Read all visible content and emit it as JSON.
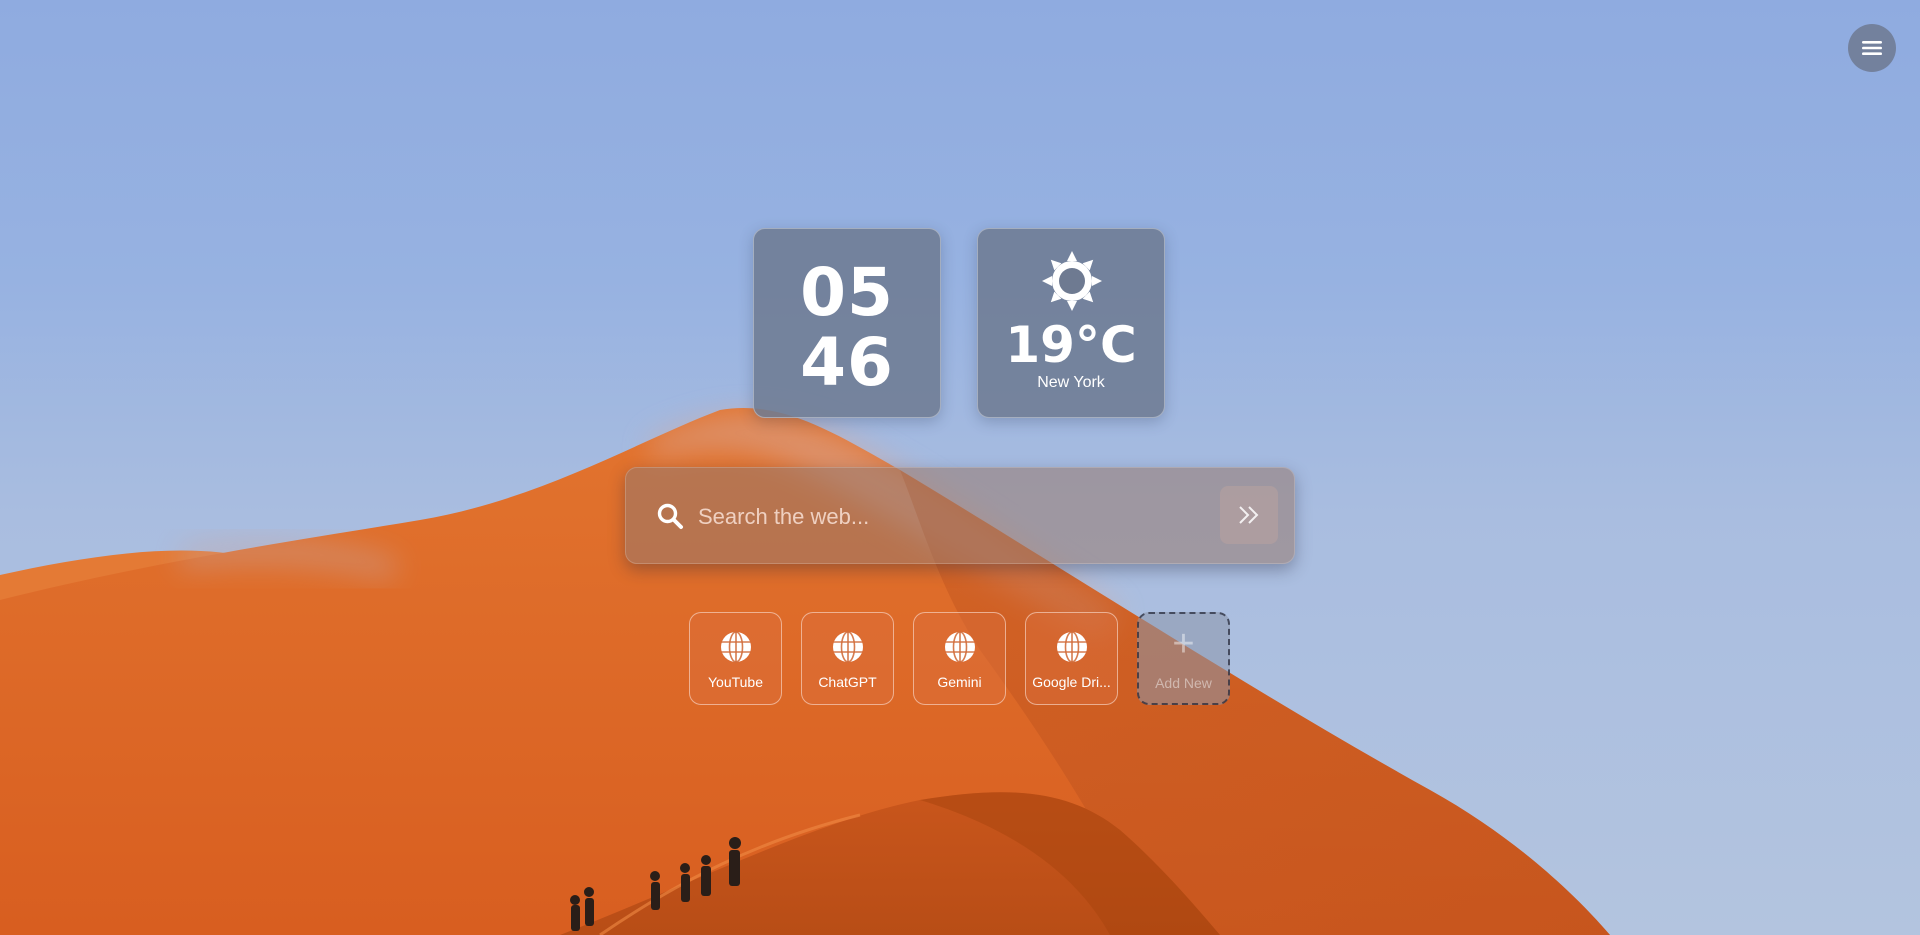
{
  "clock": {
    "hours": "05",
    "minutes": "46"
  },
  "weather": {
    "icon": "sun-icon",
    "temperature": "19°C",
    "city": "New York"
  },
  "search": {
    "placeholder": "Search the web...",
    "value": ""
  },
  "shortcuts": [
    {
      "label": "YouTube",
      "icon": "globe-icon"
    },
    {
      "label": "ChatGPT",
      "icon": "globe-icon"
    },
    {
      "label": "Gemini",
      "icon": "globe-icon"
    },
    {
      "label": "Google Dri...",
      "icon": "globe-icon"
    }
  ],
  "add_shortcut": {
    "label": "Add New",
    "icon": "+"
  },
  "icons": {
    "menu": "hamburger-menu-icon",
    "search": "search-icon",
    "submit": "double-chevron-right-icon"
  },
  "colors": {
    "sky": "#95b0e0",
    "dune": "#e06a2a",
    "widget": "#6e7a91"
  }
}
